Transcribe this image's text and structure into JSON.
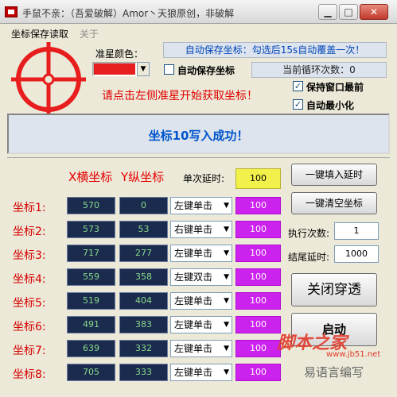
{
  "window": {
    "title": "手鼠不亲：（吾爱破解）Amor丶天狼原创，非破解",
    "minimize_icon": "minimize-icon",
    "maximize_icon": "maximize-icon",
    "close_icon": "close-icon"
  },
  "menu": {
    "items": [
      {
        "label": "坐标保存读取",
        "enabled": true
      },
      {
        "label": "关于",
        "enabled": false
      }
    ]
  },
  "settings": {
    "crosshair_icon": "crosshair-icon",
    "crosshair_color": "#e81d1d",
    "color_label": "准星颜色：",
    "selected_color": "#e81d1d",
    "auto_save_label": "自动保存坐标",
    "auto_save_checked": false,
    "auto_save_hint": "自动保存坐标：勾选后15s自动覆盖一次！",
    "loop_count_text": "当前循环次数：0",
    "keep_on_top_label": "保持窗口最前",
    "keep_on_top_checked": true,
    "auto_minimize_label": "自动最小化",
    "auto_minimize_checked": true,
    "instruction": "请点击左侧准星开始获取坐标！"
  },
  "status": {
    "message": "坐标10写入成功！"
  },
  "coords_table": {
    "x_header": "X横坐标",
    "y_header": "Y纵坐标",
    "delay_label": "单次延时:",
    "single_delay_value": "100",
    "rows": [
      {
        "label": "坐标1:",
        "x": "570",
        "y": "0",
        "action": "左键单击",
        "delay": "100"
      },
      {
        "label": "坐标2:",
        "x": "573",
        "y": "53",
        "action": "右键单击",
        "delay": "100"
      },
      {
        "label": "坐标3:",
        "x": "717",
        "y": "277",
        "action": "左键单击",
        "delay": "100"
      },
      {
        "label": "坐标4:",
        "x": "559",
        "y": "358",
        "action": "左键双击",
        "delay": "100"
      },
      {
        "label": "坐标5:",
        "x": "519",
        "y": "404",
        "action": "左键单击",
        "delay": "100"
      },
      {
        "label": "坐标6:",
        "x": "491",
        "y": "383",
        "action": "左键单击",
        "delay": "100"
      },
      {
        "label": "坐标7:",
        "x": "639",
        "y": "332",
        "action": "左键单击",
        "delay": "100"
      },
      {
        "label": "坐标8:",
        "x": "705",
        "y": "333",
        "action": "左键单击",
        "delay": "100"
      }
    ]
  },
  "actions": {
    "fill_delay_button": "一键填入延时",
    "clear_coords_button": "一键清空坐标",
    "exec_count_label": "执行次数:",
    "exec_count_value": "1",
    "end_delay_label": "结尾延时:",
    "end_delay_value": "1000",
    "passthrough_button": "关闭穿透",
    "start_button": "启动"
  },
  "watermark": {
    "site_name": "脚本之家",
    "site_url": "www.jb51.net",
    "footer": "易语言编写"
  }
}
